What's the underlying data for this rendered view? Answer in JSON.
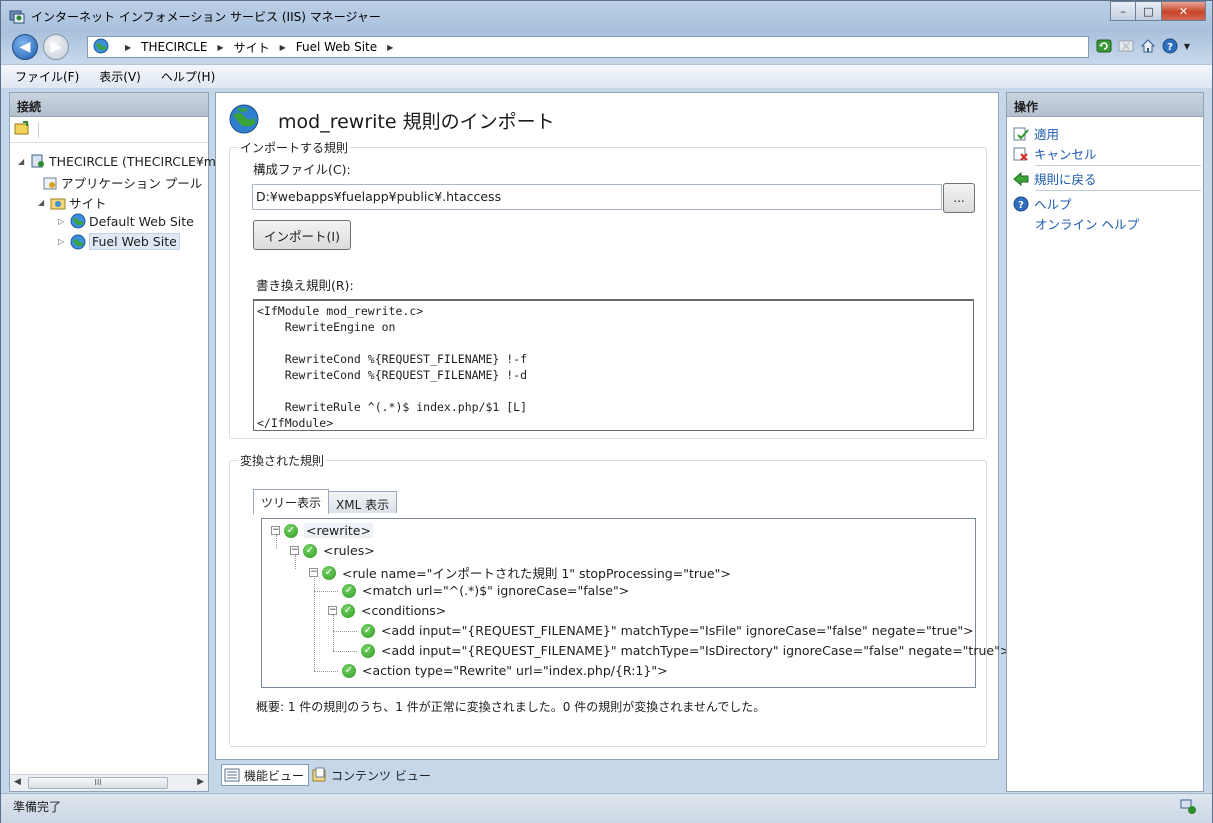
{
  "window": {
    "title": "インターネット インフォメーション サービス (IIS) マネージャー",
    "minimize": "–",
    "maximize": "□",
    "close": "✕"
  },
  "address": {
    "crumbs": [
      "THECIRCLE",
      "サイト",
      "Fuel Web Site"
    ]
  },
  "menu": {
    "file": "ファイル(F)",
    "view": "表示(V)",
    "help": "ヘルプ(H)"
  },
  "connections": {
    "header": "接続",
    "tree": {
      "server": "THECIRCLE (THECIRCLE¥m",
      "app_pools": "アプリケーション プール",
      "sites": "サイト",
      "default_site": "Default Web Site",
      "fuel_site": "Fuel Web Site"
    },
    "scroll_thumb": "III"
  },
  "main": {
    "title": "mod_rewrite 規則のインポート",
    "import_group": "インポートする規則",
    "config_label": "構成ファイル(C):",
    "config_value": "D:¥webapps¥fuelapp¥public¥.htaccess",
    "browse_label": "...",
    "import_button": "インポート(I)",
    "rewrite_label": "書き換え規則(R):",
    "rewrite_text": "<IfModule mod_rewrite.c>\n    RewriteEngine on\n\n    RewriteCond %{REQUEST_FILENAME} !-f\n    RewriteCond %{REQUEST_FILENAME} !-d\n\n    RewriteRule ^(.*)$ index.php/$1 [L]\n</IfModule>",
    "converted_group": "変換された規則",
    "tab_tree": "ツリー表示",
    "tab_xml": "XML 表示",
    "rules": {
      "rewrite": "<rewrite>",
      "rules": "<rules>",
      "rule": "<rule name=\"インポートされた規則 1\" stopProcessing=\"true\">",
      "match": "<match url=\"^(.*)$\" ignoreCase=\"false\">",
      "conditions": "<conditions>",
      "add_file": "<add input=\"{REQUEST_FILENAME}\" matchType=\"IsFile\" ignoreCase=\"false\" negate=\"true\">",
      "add_dir": "<add input=\"{REQUEST_FILENAME}\" matchType=\"IsDirectory\" ignoreCase=\"false\" negate=\"true\">",
      "action": "<action type=\"Rewrite\" url=\"index.php/{R:1}\">"
    },
    "summary": "概要: 1 件の規則のうち、1 件が正常に変換されました。0 件の規則が変換されませんでした。"
  },
  "bottom_tabs": {
    "features": "機能ビュー",
    "content": "コンテンツ ビュー"
  },
  "actions": {
    "header": "操作",
    "apply": "適用",
    "cancel": "キャンセル",
    "back": "規則に戻る",
    "help": "ヘルプ",
    "online_help": "オンライン ヘルプ"
  },
  "status": {
    "text": "準備完了"
  }
}
